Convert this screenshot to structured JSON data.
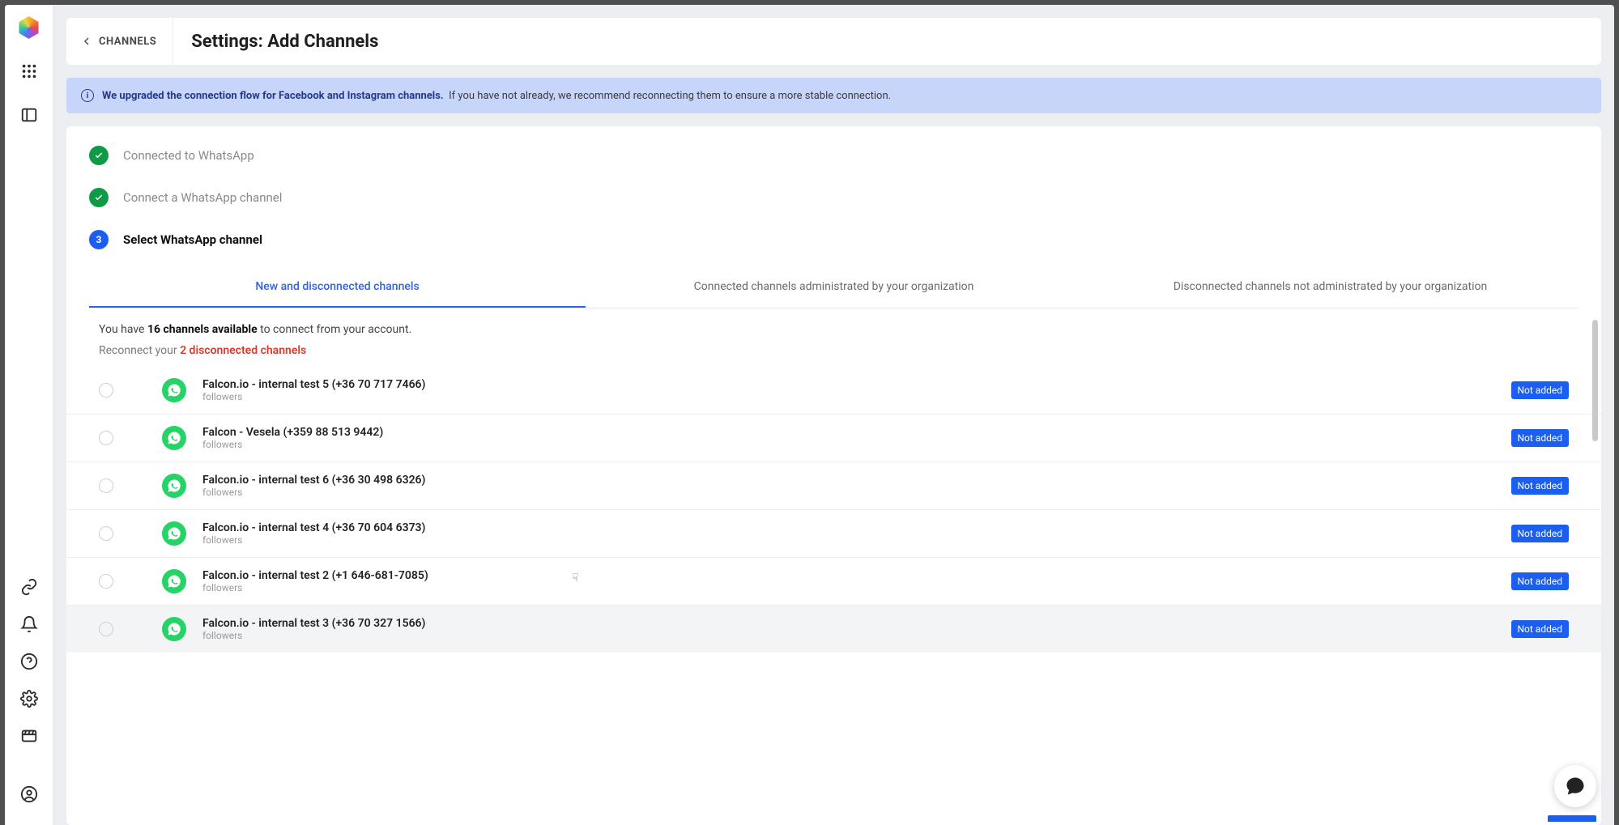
{
  "header": {
    "back_label": "CHANNELS",
    "title": "Settings: Add Channels"
  },
  "banner": {
    "lead": "We upgraded the connection flow for Facebook and Instagram channels.",
    "rest": "If you have not already, we recommend reconnecting them to ensure a more stable connection."
  },
  "steps": [
    {
      "state": "done",
      "label": "Connected to WhatsApp"
    },
    {
      "state": "done",
      "label": "Connect a WhatsApp channel"
    },
    {
      "state": "active",
      "num": "3",
      "label": "Select WhatsApp channel"
    }
  ],
  "tabs": [
    {
      "label": "New and disconnected channels",
      "active": true
    },
    {
      "label": "Connected channels administrated by your organization",
      "active": false
    },
    {
      "label": "Disconnected channels not administrated by your organization",
      "active": false
    }
  ],
  "summary": {
    "prefix": "You have ",
    "count": "16 channels available",
    "suffix": " to connect from your account."
  },
  "warn": {
    "prefix": "Reconnect your ",
    "count": "2 disconnected channels"
  },
  "channels": [
    {
      "name": "Falcon.io - internal test 5 (+36 70 717 7466)",
      "sub": "followers",
      "badge": "Not added"
    },
    {
      "name": "Falcon - Vesela (+359 88 513 9442)",
      "sub": "followers",
      "badge": "Not added"
    },
    {
      "name": "Falcon.io - internal test 6 (+36 30 498 6326)",
      "sub": "followers",
      "badge": "Not added"
    },
    {
      "name": "Falcon.io - internal test 4 (+36 70 604 6373)",
      "sub": "followers",
      "badge": "Not added"
    },
    {
      "name": "Falcon.io - internal test 2 (+1 646-681-7085)",
      "sub": "followers",
      "badge": "Not added"
    },
    {
      "name": "Falcon.io - internal test 3 (+36 70 327 1566)",
      "sub": "followers",
      "badge": "Not added"
    }
  ]
}
